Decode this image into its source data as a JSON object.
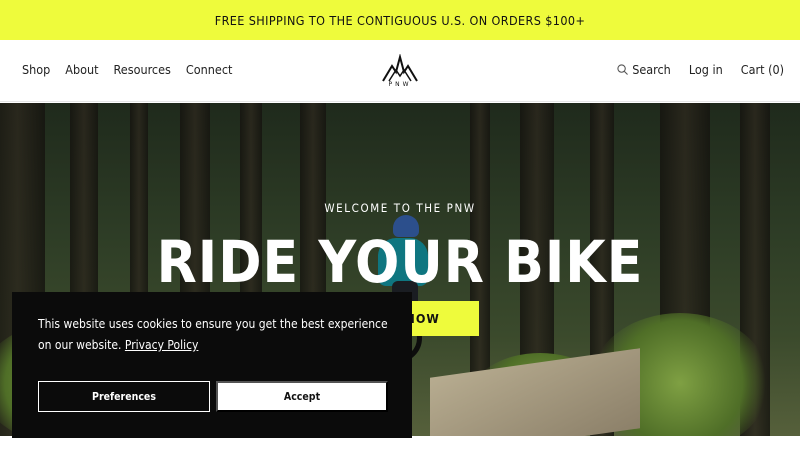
{
  "announcement": "FREE SHIPPING TO THE CONTIGUOUS U.S. ON ORDERS $100+",
  "nav": {
    "left": [
      "Shop",
      "About",
      "Resources",
      "Connect"
    ],
    "search": "Search",
    "login": "Log in",
    "cart": "Cart (0)"
  },
  "logo": {
    "text": "PNW"
  },
  "hero": {
    "kicker": "WELCOME TO THE PNW",
    "title": "RIDE YOUR BIKE",
    "button": "SHOP NOW"
  },
  "cookie": {
    "text": "This website uses cookies to ensure you get the best experience on our website.",
    "link": "Privacy Policy",
    "preferences": "Preferences",
    "accept": "Accept"
  },
  "colors": {
    "accent": "#eefb3c",
    "banner_bg": "#0b0b0b"
  }
}
